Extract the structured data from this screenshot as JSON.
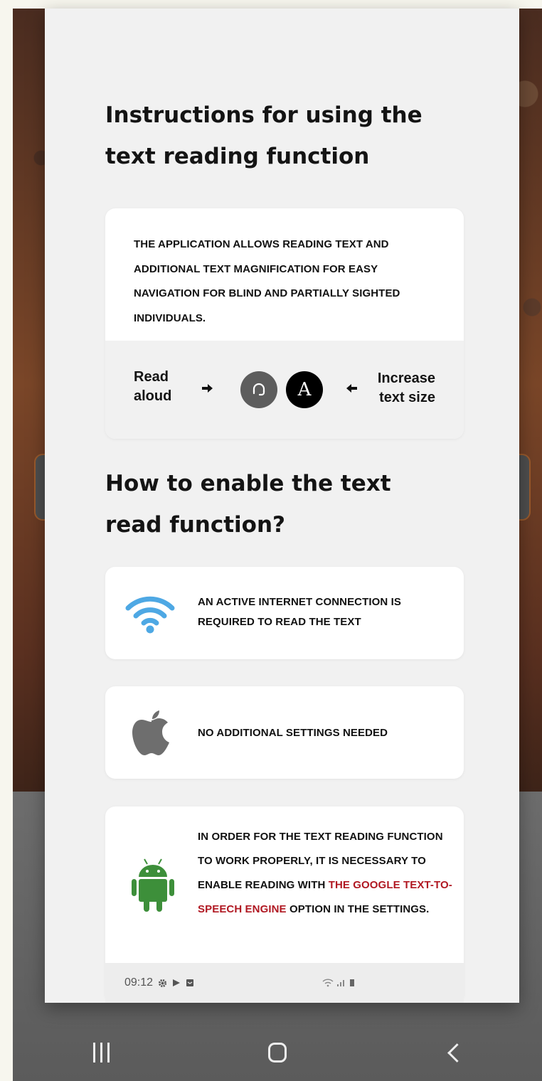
{
  "dialog": {
    "title": "Instructions for using the text reading function",
    "intro": {
      "text": "THE APPLICATION ALLOWS READING TEXT AND ADDITIONAL TEXT MAGNIFICATION FOR EASY NAVIGATION FOR BLIND AND PARTIALLY SIGHTED INDIVIDUALS.",
      "read_aloud_label_1": "Read",
      "read_aloud_label_2": "aloud",
      "increase_label_1": "Increase",
      "increase_label_2": "text size",
      "font_icon_letter": "A"
    },
    "subtitle": "How to enable the text read function?",
    "requirements": [
      {
        "icon": "wifi-icon",
        "text": "AN ACTIVE INTERNET CONNECTION IS REQUIRED TO READ THE TEXT"
      },
      {
        "icon": "apple-icon",
        "text": "NO ADDITIONAL SETTINGS NEEDED"
      },
      {
        "icon": "android-icon",
        "text_before": "IN ORDER FOR THE TEXT READING FUNCTION TO WORK PROPERLY, IT IS NECESSARY TO ENABLE READING WITH",
        "highlight": "THE GOOGLE TEXT-TO-SPEECH ENGINE",
        "text_after": "OPTION IN THE SETTINGS."
      }
    ],
    "status_bar": {
      "time": "09:12"
    }
  },
  "colors": {
    "accent_red": "#b01822",
    "wifi_blue": "#4ea8e4",
    "android_green": "#3d8f3a",
    "apple_gray": "#6e6e6e",
    "audio_button": "#5d5d5d",
    "font_button": "#000000"
  }
}
